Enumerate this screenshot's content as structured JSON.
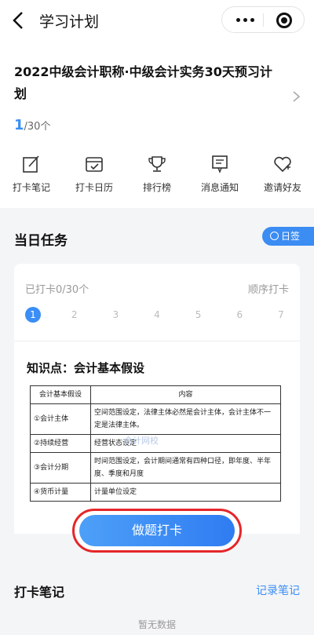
{
  "topbar": {
    "title": "学习计划"
  },
  "course": {
    "name": "2022中级会计职称·中级会计实务30天预习计划",
    "progress_current": "1",
    "progress_total": "/30个"
  },
  "menu": [
    {
      "label": "打卡笔记",
      "icon": "edit-icon"
    },
    {
      "label": "打卡日历",
      "icon": "calendar-icon"
    },
    {
      "label": "排行榜",
      "icon": "trophy-icon"
    },
    {
      "label": "消息通知",
      "icon": "message-icon"
    },
    {
      "label": "邀请好友",
      "icon": "heart-icon"
    }
  ],
  "daily": {
    "title": "当日任务",
    "sign_label": "日签",
    "done_text": "已打卡0/30个",
    "mode_text": "顺序打卡",
    "days": [
      "1",
      "2",
      "3",
      "4",
      "5",
      "6",
      "7"
    ],
    "active_day": "1"
  },
  "knowledge": {
    "title": "知识点：会计基本假设",
    "table_headers": [
      "会计基本假设",
      "内容"
    ],
    "rows": [
      [
        "①会计主体",
        "空间范围设定，法律主体必然是会计主体，会计主体不一定是法律主体。"
      ],
      [
        "②持续经营",
        "经营状态设定"
      ],
      [
        "③会计分期",
        "时间范围设定，会计期间通常有四种口径，即年度、半年度、季度和月度"
      ],
      [
        "④货币计量",
        "计量单位设定"
      ]
    ],
    "watermark": "会计网校"
  },
  "actions": {
    "do_button": "做题打卡"
  },
  "notes": {
    "title": "打卡笔记",
    "record": "记录笔记",
    "empty": "暂无数据"
  },
  "colors": {
    "accent": "#3a8ef6",
    "highlight_ring": "#e5262a"
  }
}
